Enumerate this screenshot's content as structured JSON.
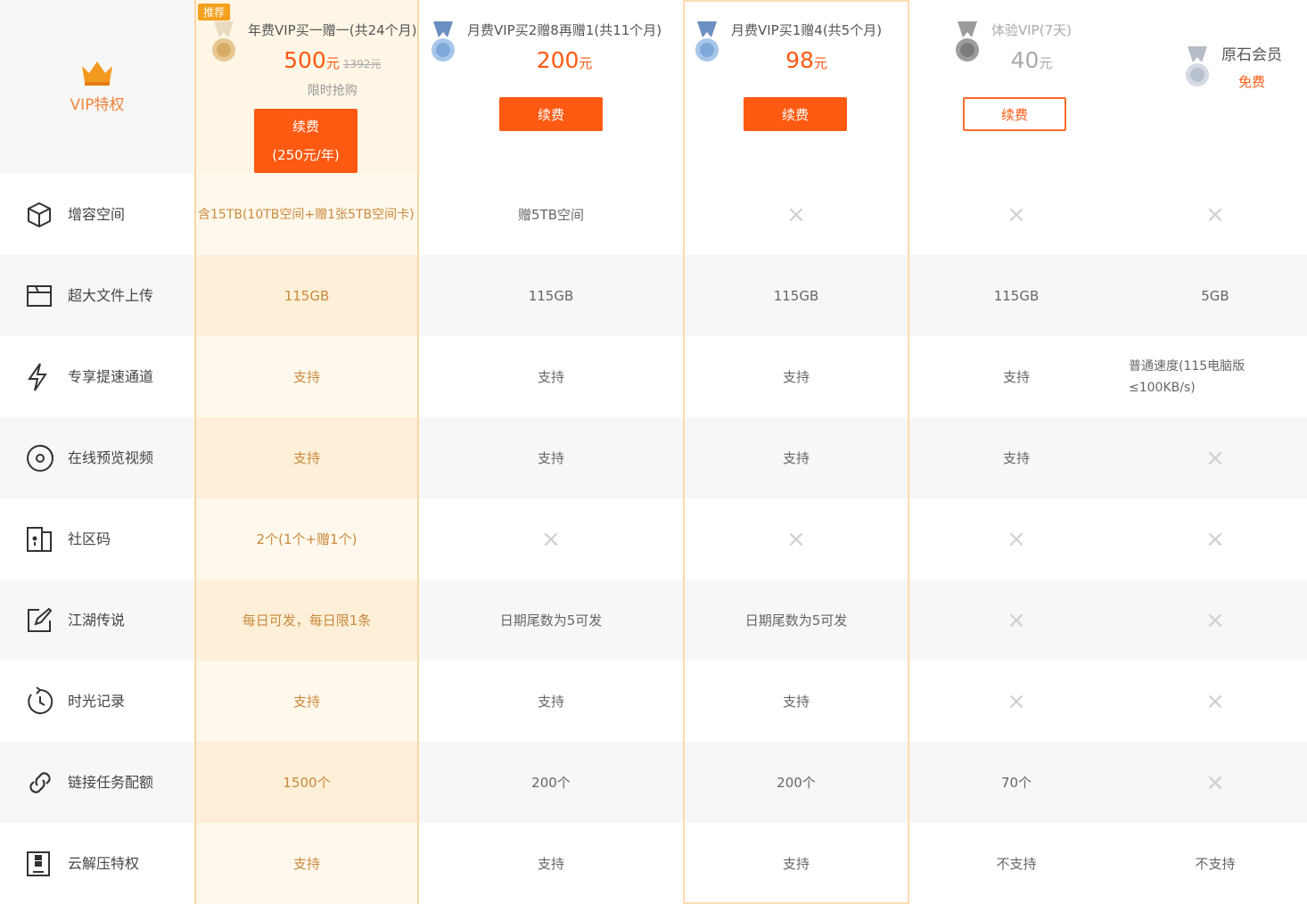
{
  "header": {
    "vip_label": "VIP特权",
    "recommend_badge": "推荐",
    "plans": [
      {
        "name": "年费VIP买一赠一(共24个月)",
        "price": "500",
        "unit": "元",
        "original": "1392元",
        "promo": "限时抢购",
        "button_line1": "续费",
        "button_line2": "(250元/年)"
      },
      {
        "name": "月费VIP买2赠8再赠1(共11个月)",
        "price": "200",
        "unit": "元",
        "button": "续费"
      },
      {
        "name": "月费VIP买1赠4(共5个月)",
        "price": "98",
        "unit": "元",
        "button": "续费"
      },
      {
        "name": "体验VIP(7天)",
        "price": "40",
        "unit": "元",
        "button": "续费"
      },
      {
        "name": "原石会员",
        "price_text": "免费"
      }
    ]
  },
  "colors": {
    "accent": "#ff5a12",
    "highlight_bg": "#fff8ec",
    "highlight_text": "#c98a3c"
  },
  "rows": [
    {
      "icon": "cube-icon",
      "label": "增容空间",
      "values": [
        "含15TB(10TB空间+赠1张5TB空间卡)",
        "赠5TB空间",
        "×",
        "×",
        "×"
      ]
    },
    {
      "icon": "folder-upload-icon",
      "label": "超大文件上传",
      "values": [
        "115GB",
        "115GB",
        "115GB",
        "115GB",
        "5GB"
      ]
    },
    {
      "icon": "lightning-icon",
      "label": "专享提速通道",
      "values": [
        "支持",
        "支持",
        "支持",
        "支持",
        "普通速度(115电脑版≤100KB/s)"
      ]
    },
    {
      "icon": "disc-play-icon",
      "label": "在线预览视频",
      "values": [
        "支持",
        "支持",
        "支持",
        "支持",
        "×"
      ]
    },
    {
      "icon": "community-door-icon",
      "label": "社区码",
      "values": [
        "2个(1个+赠1个)",
        "×",
        "×",
        "×",
        "×"
      ]
    },
    {
      "icon": "edit-icon",
      "label": "江湖传说",
      "values": [
        "每日可发，每日限1条",
        "日期尾数为5可发",
        "日期尾数为5可发",
        "×",
        "×"
      ]
    },
    {
      "icon": "clock-rewind-icon",
      "label": "时光记录",
      "values": [
        "支持",
        "支持",
        "支持",
        "×",
        "×"
      ]
    },
    {
      "icon": "link-icon",
      "label": "链接任务配额",
      "values": [
        "1500个",
        "200个",
        "200个",
        "70个",
        "×"
      ]
    },
    {
      "icon": "archive-icon",
      "label": "云解压特权",
      "values": [
        "支持",
        "支持",
        "支持",
        "不支持",
        "不支持"
      ]
    }
  ]
}
